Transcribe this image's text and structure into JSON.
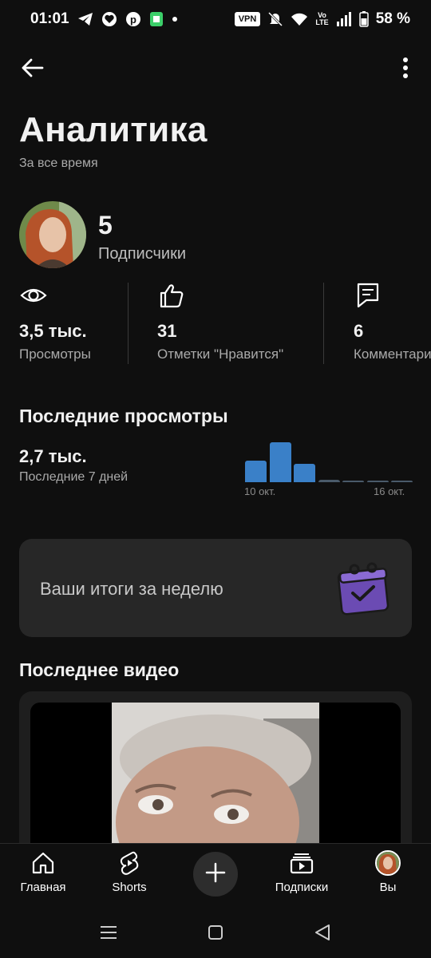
{
  "status_bar": {
    "time": "01:01",
    "vpn": "VPN",
    "volte": "Vo LTE",
    "battery": "58 %",
    "left_icons": [
      "telegram-icon",
      "heart-icon",
      "pinterest-icon",
      "app-icon",
      "dot-icon"
    ],
    "right_icons": [
      "vpn-icon",
      "muted-bell-icon",
      "wifi-icon",
      "volte-icon",
      "signal-icon",
      "battery-icon"
    ]
  },
  "header": {
    "title": "Аналитика",
    "subtitle": "За все время"
  },
  "channel": {
    "subscribers_count": "5",
    "subscribers_label": "Подписчики"
  },
  "stats": [
    {
      "icon": "eye-icon",
      "value": "3,5 тыс.",
      "label": "Просмотры"
    },
    {
      "icon": "thumbs-up-icon",
      "value": "31",
      "label": "Отметки \"Нравится\""
    },
    {
      "icon": "comment-icon",
      "value": "6",
      "label": "Комментарии"
    }
  ],
  "recent_views": {
    "title": "Последние просмотры",
    "value": "2,7 тыс.",
    "period": "Последние 7 дней",
    "chart_data": {
      "type": "bar",
      "values": [
        26,
        49,
        23,
        3,
        1,
        1,
        2
      ],
      "x_start_label": "10 окт.",
      "x_end_label": "16 окт.",
      "color": "#3a80c8"
    }
  },
  "weekly_card": {
    "text": "Ваши итоги за неделю",
    "icon": "calendar-check-icon",
    "icon_color": "#6b4bb3"
  },
  "latest_video": {
    "title": "Последнее видео"
  },
  "bottom_nav": {
    "items": [
      {
        "label": "Главная",
        "icon": "home-icon"
      },
      {
        "label": "Shorts",
        "icon": "shorts-icon"
      },
      {
        "label": "",
        "icon": "plus-icon"
      },
      {
        "label": "Подписки",
        "icon": "subscriptions-icon"
      },
      {
        "label": "Вы",
        "icon": "avatar"
      }
    ]
  },
  "system_nav": [
    "menu-icon",
    "home-square-icon",
    "back-triangle-icon"
  ]
}
